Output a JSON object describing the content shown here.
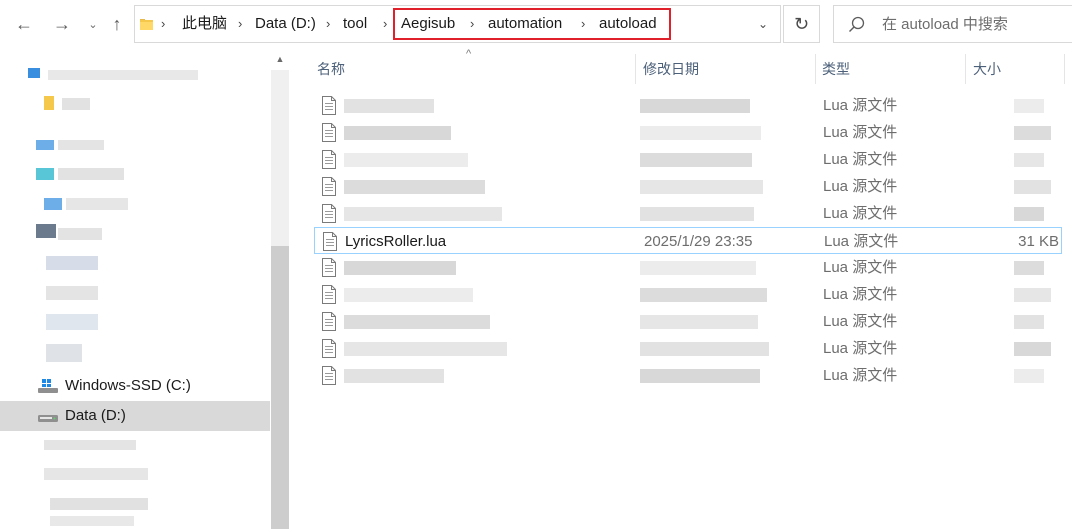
{
  "toolbar": {
    "back_icon": "arrow-left-icon",
    "forward_icon": "arrow-right-icon",
    "recent_icon": "chevron-down-icon",
    "up_icon": "arrow-up-icon",
    "back_glyph": "←",
    "forward_glyph": "→",
    "recent_glyph": "⌄",
    "up_glyph": "↑",
    "refresh_glyph": "↻",
    "dropdown_glyph": "⌄"
  },
  "address_bar": {
    "segments": [
      "此电脑",
      "Data (D:)",
      "tool",
      "Aegisub",
      "automation",
      "autoload"
    ],
    "separator": "›",
    "highlight_color": "#e0202a"
  },
  "search": {
    "placeholder": "在 autoload 中搜索"
  },
  "navigation": {
    "drives": [
      {
        "label": "Windows-SSD (C:)",
        "selected": false
      },
      {
        "label": "Data (D:)",
        "selected": true
      }
    ]
  },
  "columns": {
    "sort_glyph": "^",
    "name": "名称",
    "date": "修改日期",
    "type": "类型",
    "size": "大小"
  },
  "files": [
    {
      "name": "",
      "date": "",
      "type": "Lua 源文件",
      "size": "",
      "blurred": true
    },
    {
      "name": "",
      "date": "",
      "type": "Lua 源文件",
      "size": "",
      "blurred": true
    },
    {
      "name": "",
      "date": "",
      "type": "Lua 源文件",
      "size": "",
      "blurred": true
    },
    {
      "name": "",
      "date": "",
      "type": "Lua 源文件",
      "size": "",
      "blurred": true
    },
    {
      "name": "",
      "date": "",
      "type": "Lua 源文件",
      "size": "",
      "blurred": true
    },
    {
      "name": "LyricsRoller.lua",
      "date": "2025/1/29 23:35",
      "type": "Lua 源文件",
      "size": "31 KB",
      "blurred": false
    },
    {
      "name": "",
      "date": "",
      "type": "Lua 源文件",
      "size": "",
      "blurred": true
    },
    {
      "name": "",
      "date": "",
      "type": "Lua 源文件",
      "size": "",
      "blurred": true
    },
    {
      "name": "",
      "date": "",
      "type": "Lua 源文件",
      "size": "",
      "blurred": true
    },
    {
      "name": "",
      "date": "",
      "type": "Lua 源文件",
      "size": "",
      "blurred": true
    },
    {
      "name": "",
      "date": "",
      "type": "Lua 源文件",
      "size": "",
      "blurred": true
    }
  ],
  "colors": {
    "selection_border": "#99d1ff",
    "selected_nav_bg": "#d9d9d9",
    "header_text": "#4c607a"
  }
}
